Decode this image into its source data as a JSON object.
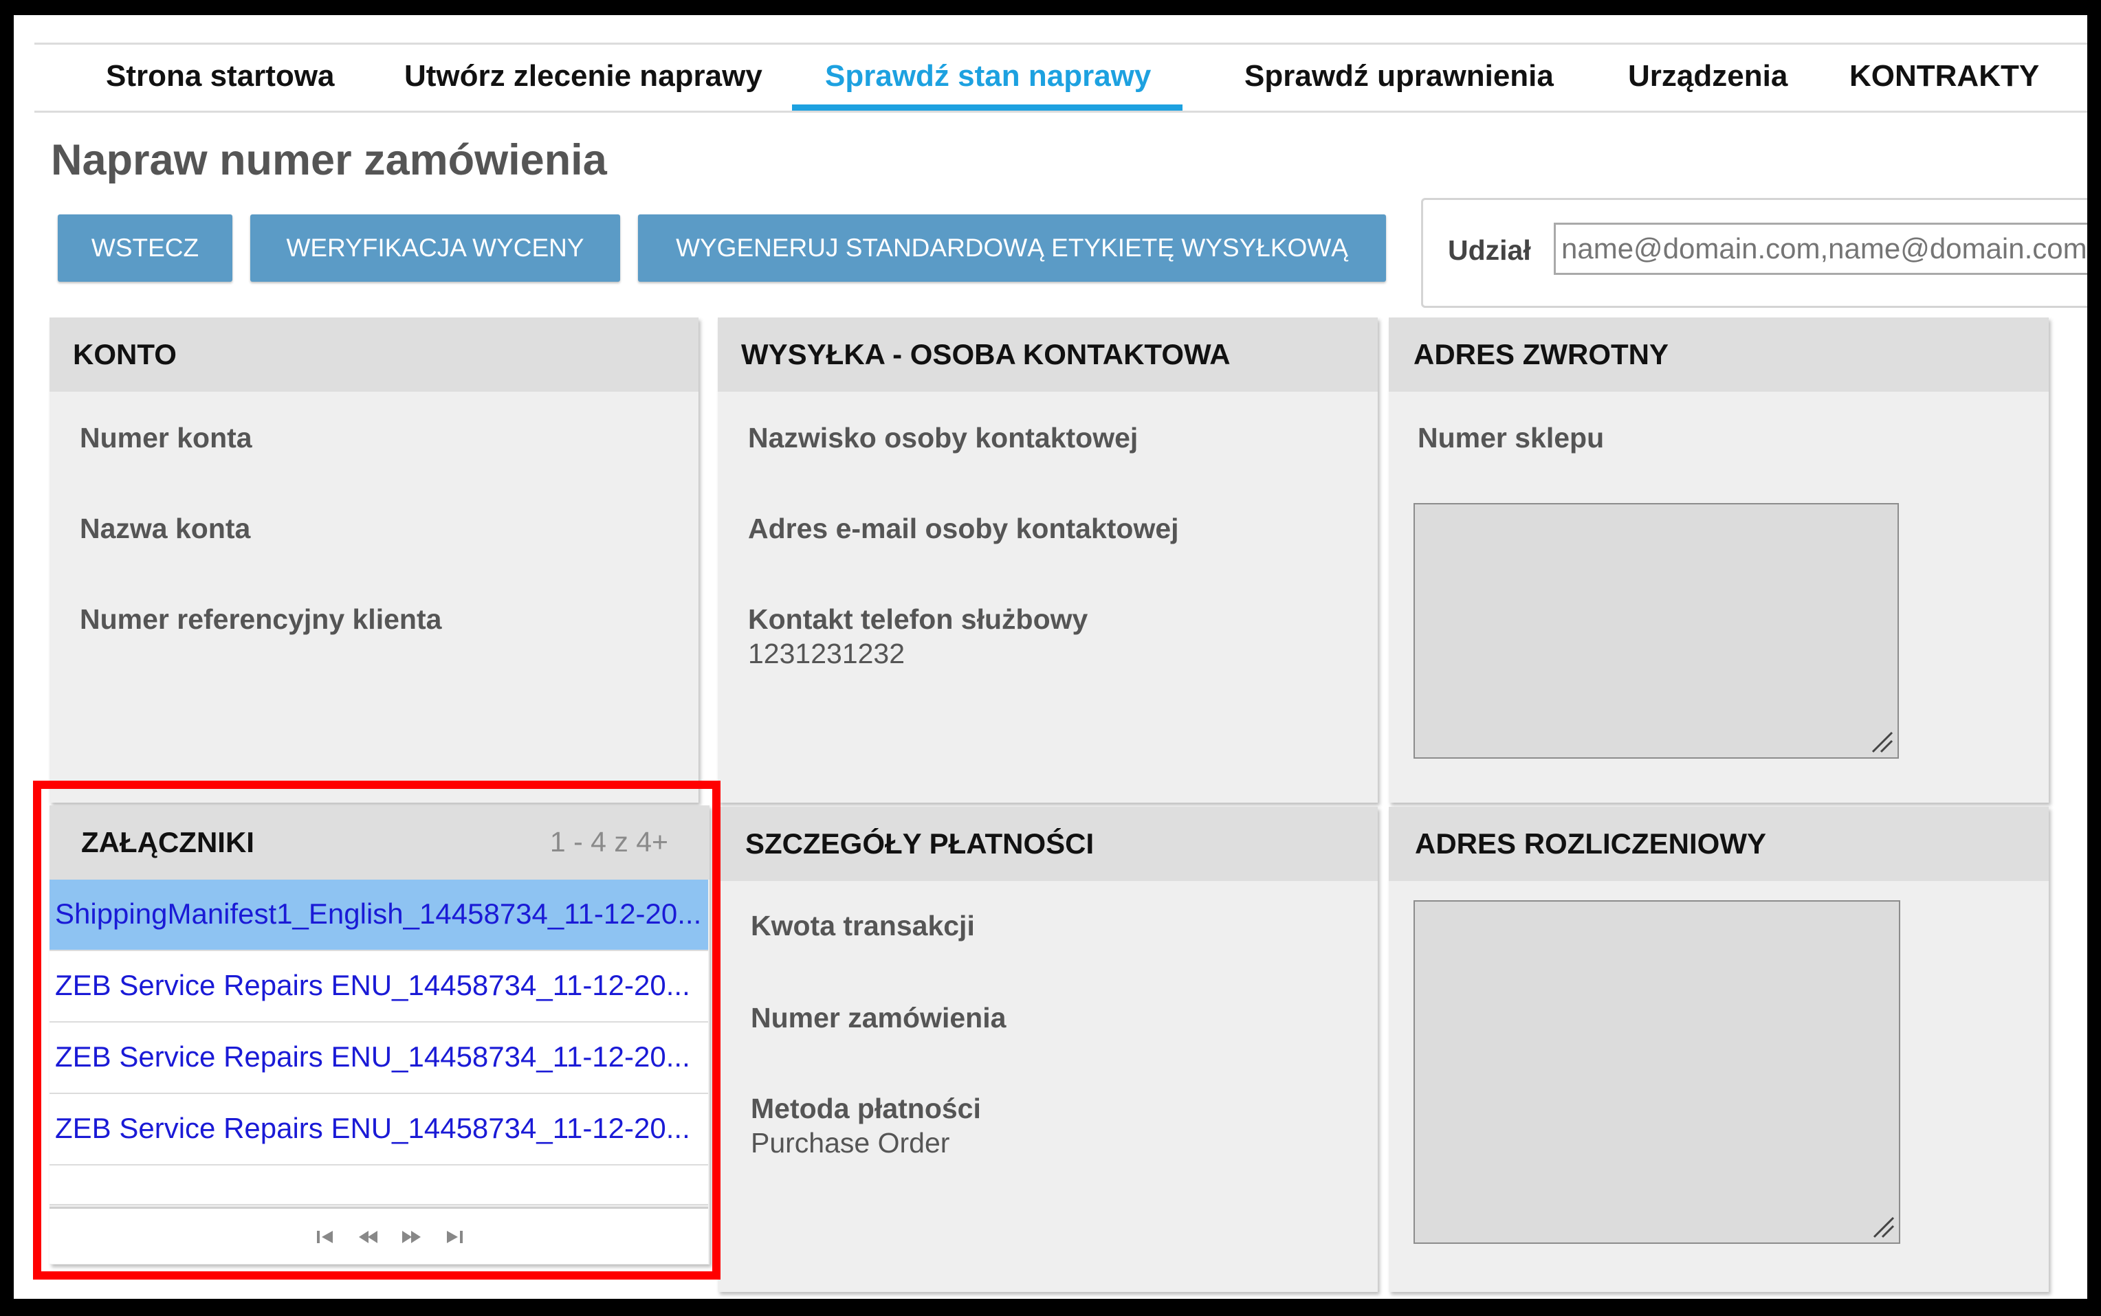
{
  "nav": {
    "tabs": [
      {
        "label": "Strona startowa",
        "active": false
      },
      {
        "label": "Utwórz zlecenie naprawy",
        "active": false
      },
      {
        "label": "Sprawdź stan naprawy",
        "active": true
      },
      {
        "label": "Sprawdź uprawnienia",
        "active": false
      },
      {
        "label": "Urządzenia",
        "active": false
      },
      {
        "label": "KONTRAKTY",
        "active": false
      }
    ]
  },
  "page": {
    "title": "Napraw numer zamówienia"
  },
  "toolbar": {
    "back_label": "WSTECZ",
    "quote_verify_label": "WERYFIKACJA WYCENY",
    "generate_label_label": "WYGENERUJ STANDARDOWĄ ETYKIETĘ WYSYŁKOWĄ"
  },
  "share": {
    "label": "Udział",
    "placeholder": "name@domain.com,name@domain.com",
    "value": ""
  },
  "account": {
    "title": "KONTO",
    "account_number_label": "Numer konta",
    "account_name_label": "Nazwa konta",
    "customer_ref_label": "Numer referencyjny klienta"
  },
  "shipping_contact": {
    "title": "WYSYŁKA - OSOBA KONTAKTOWA",
    "contact_name_label": "Nazwisko osoby kontaktowej",
    "contact_email_label": "Adres e-mail osoby kontaktowej",
    "work_phone_label": "Kontakt telefon służbowy",
    "work_phone_value": "1231231232"
  },
  "return_address": {
    "title": "ADRES ZWROTNY",
    "store_number_label": "Numer sklepu"
  },
  "attachments": {
    "title": "ZAŁĄCZNIKI",
    "count": "1 - 4 z 4+",
    "items": [
      "ShippingManifest1_English_14458734_11-12-20...",
      "ZEB Service Repairs ENU_14458734_11-12-20...",
      "ZEB Service Repairs ENU_14458734_11-12-20...",
      "ZEB Service Repairs ENU_14458734_11-12-20..."
    ]
  },
  "payment": {
    "title": "SZCZEGÓŁY PŁATNOŚCI",
    "amount_label": "Kwota transakcji",
    "order_number_label": "Numer zamówienia",
    "method_label": "Metoda płatności",
    "method_value": "Purchase Order"
  },
  "billing_address": {
    "title": "ADRES ROZLICZENIOWY"
  },
  "colors": {
    "accent": "#1da1e0",
    "button": "#5b9bc6",
    "highlight": "#ff0000",
    "selected_row": "#8ec3f2",
    "link": "#1a1ad6"
  }
}
